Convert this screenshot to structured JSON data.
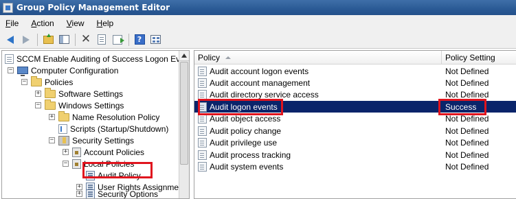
{
  "window": {
    "title": "Group Policy Management Editor"
  },
  "menu": {
    "items": [
      "File",
      "Action",
      "View",
      "Help"
    ]
  },
  "toolbar": {
    "buttons": [
      "back-icon",
      "forward-icon",
      "up-folder-icon",
      "show-hide-tree-icon",
      "delete-icon",
      "properties-icon",
      "export-list-icon",
      "help-icon",
      "show-pane-icon"
    ]
  },
  "tree": {
    "root": "SCCM Enable Auditing of Success Logon Events",
    "computer_configuration": "Computer Configuration",
    "policies": "Policies",
    "software_settings": "Software Settings",
    "windows_settings": "Windows Settings",
    "name_resolution_policy": "Name Resolution Policy",
    "scripts": "Scripts (Startup/Shutdown)",
    "security_settings": "Security Settings",
    "account_policies": "Account Policies",
    "local_policies": "Local Policies",
    "audit_policy": "Audit Policy",
    "user_rights_assignment": "User Rights Assignment",
    "security_options": "Security Options",
    "expand_plus": "+",
    "expand_minus": "−"
  },
  "list": {
    "columns": {
      "policy": "Policy",
      "setting": "Policy Setting"
    },
    "rows": [
      {
        "policy": "Audit account logon events",
        "setting": "Not Defined"
      },
      {
        "policy": "Audit account management",
        "setting": "Not Defined"
      },
      {
        "policy": "Audit directory service access",
        "setting": "Not Defined"
      },
      {
        "policy": "Audit logon events",
        "setting": "Success"
      },
      {
        "policy": "Audit object access",
        "setting": "Not Defined"
      },
      {
        "policy": "Audit policy change",
        "setting": "Not Defined"
      },
      {
        "policy": "Audit privilege use",
        "setting": "Not Defined"
      },
      {
        "policy": "Audit process tracking",
        "setting": "Not Defined"
      },
      {
        "policy": "Audit system events",
        "setting": "Not Defined"
      }
    ],
    "selected_index": 3
  },
  "colors": {
    "selection": "#0a246a",
    "highlight_annotation": "#e0141e",
    "titlebar": "#2a5a95"
  }
}
